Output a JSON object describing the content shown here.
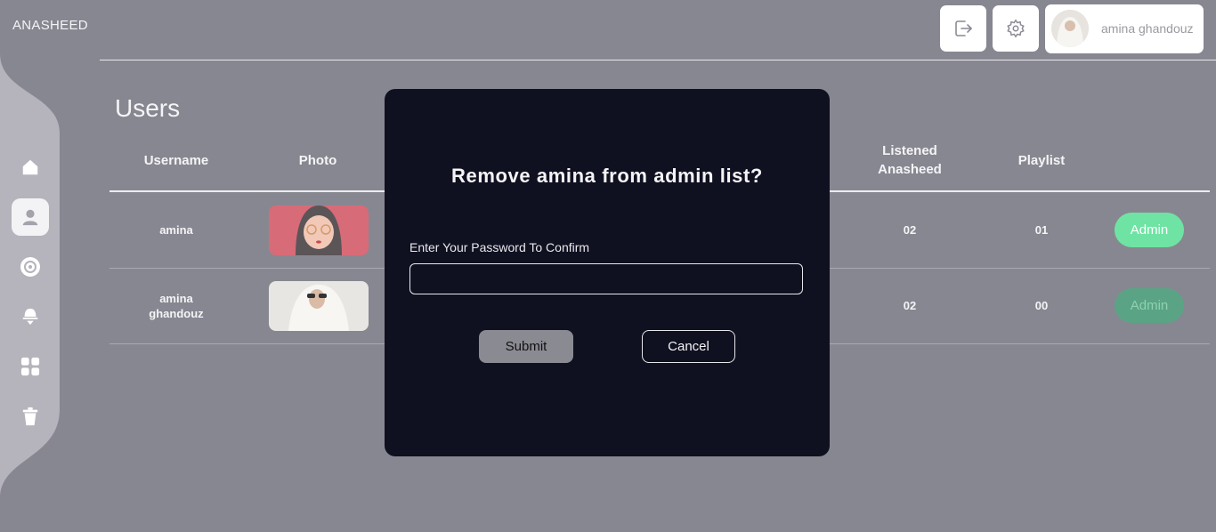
{
  "app": {
    "logo": "ANASHEED"
  },
  "header": {
    "logout_icon": "logout-icon",
    "settings_icon": "gear-icon",
    "user_name": "amina ghandouz"
  },
  "sidebar": {
    "items": [
      {
        "icon": "home-icon",
        "active": false
      },
      {
        "icon": "user-icon",
        "active": true
      },
      {
        "icon": "disc-icon",
        "active": false
      },
      {
        "icon": "bell-icon",
        "active": false
      },
      {
        "icon": "grid-icon",
        "active": false
      },
      {
        "icon": "trash-icon",
        "active": false
      }
    ]
  },
  "page": {
    "title": "Users"
  },
  "table": {
    "headers": {
      "username": "Username",
      "photo": "Photo",
      "listened_line1": "Listened",
      "listened_line2": "Anasheed",
      "playlist": "Playlist"
    },
    "rows": [
      {
        "username": "amina",
        "listened": "02",
        "playlist": "01",
        "action": "Admin",
        "action_color": "#6fe3a3"
      },
      {
        "username_line1": "amina",
        "username_line2": "ghandouz",
        "listened": "02",
        "playlist": "00",
        "action": "Admin",
        "action_color": "#5aa485"
      }
    ]
  },
  "modal": {
    "title": "Remove amina from admin list?",
    "password_label": "Enter Your Password To Confirm",
    "password_value": "",
    "submit_label": "Submit",
    "cancel_label": "Cancel"
  },
  "colors": {
    "page_bg": "#878791",
    "modal_bg": "#0f1020",
    "admin_green": "#6fe3a3",
    "admin_green_muted": "#5aa485"
  }
}
